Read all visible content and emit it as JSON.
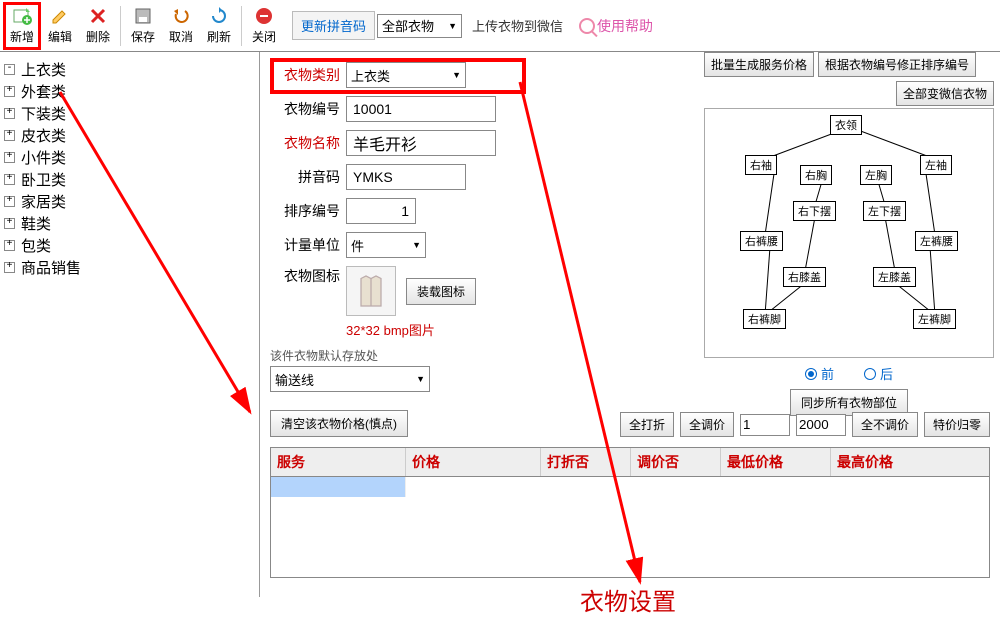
{
  "toolbar": {
    "new": "新增",
    "edit": "编辑",
    "delete": "删除",
    "save": "保存",
    "cancel": "取消",
    "refresh": "刷新",
    "close": "关闭",
    "update_pinyin": "更新拼音码",
    "all_clothes": "全部衣物",
    "upload_wechat": "上传衣物到微信",
    "help": "使用帮助"
  },
  "tree": [
    "上衣类",
    "外套类",
    "下装类",
    "皮衣类",
    "小件类",
    "卧卫类",
    "家居类",
    "鞋类",
    "包类",
    "商品销售"
  ],
  "form": {
    "category_label": "衣物类别",
    "category_value": "上衣类",
    "code_label": "衣物编号",
    "code_value": "10001",
    "name_label": "衣物名称",
    "name_value": "羊毛开衫",
    "pinyin_label": "拼音码",
    "pinyin_value": "YMKS",
    "sort_label": "排序编号",
    "sort_value": "1",
    "unit_label": "计量单位",
    "unit_value": "件",
    "icon_label": "衣物图标",
    "icon_btn": "装载图标",
    "icon_hint": "32*32 bmp图片",
    "storage_label": "该件衣物默认存放处",
    "storage_value": "输送线",
    "clear_price_btn": "清空该衣物价格(慎点)"
  },
  "right": {
    "batch_price": "批量生成服务价格",
    "fix_sort": "根据衣物编号修正排序编号",
    "all_wechat": "全部变微信衣物",
    "sync_parts": "同步所有衣物部位",
    "front": "前",
    "back": "后",
    "diagram": {
      "collar": "衣领",
      "rsleeve": "右袖",
      "lsleeve": "左袖",
      "rchest": "右胸",
      "lchest": "左胸",
      "rhem": "右下摆",
      "lhem": "左下摆",
      "rwaist": "右裤腰",
      "lwaist": "左裤腰",
      "rknee": "右膝盖",
      "lknee": "左膝盖",
      "rfoot": "右裤脚",
      "lfoot": "左裤脚"
    }
  },
  "price_bar": {
    "all_discount": "全打折",
    "all_adjust": "全调价",
    "v1": "1",
    "v2": "2000",
    "no_adjust": "全不调价",
    "reset": "特价归零"
  },
  "table": {
    "headers": [
      "服务",
      "价格",
      "打折否",
      "调价否",
      "最低价格",
      "最高价格"
    ]
  },
  "big_label": "衣物设置"
}
